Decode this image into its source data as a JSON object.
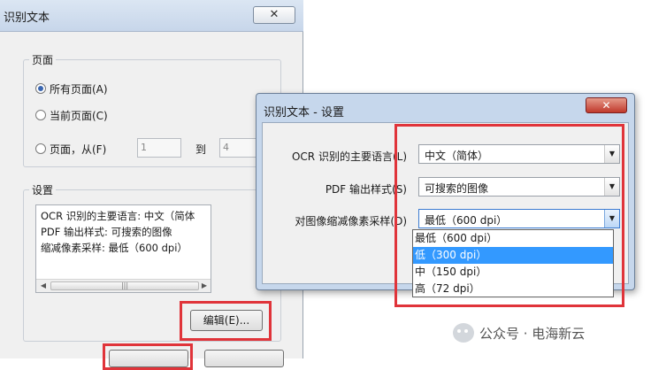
{
  "main_dialog": {
    "title": "识别文本",
    "close_symbol": "✕",
    "pages_group": {
      "label": "页面",
      "all_pages": "所有页面(A)",
      "current_page": "当前页面(C)",
      "page_range": "页面，从(F)",
      "from_value": "1",
      "to_label": "到",
      "to_value": "4",
      "selected": "all_pages"
    },
    "settings_group": {
      "label": "设置",
      "lines": [
        "OCR 识别的主要语言: 中文（简体",
        "PDF 输出样式: 可搜索的图像",
        "缩减像素采样: 最低（600 dpi）"
      ],
      "scroll_thumb_grip": "|||",
      "scroll_left": "◀",
      "scroll_right": "▶"
    },
    "edit_button": "编辑(E)..."
  },
  "settings_dialog": {
    "title": "识别文本 - 设置",
    "close_symbol": "✕",
    "fields": [
      {
        "label": "OCR 识别的主要语言(L)",
        "value": "中文（简体）"
      },
      {
        "label": "PDF 输出样式(S)",
        "value": "可搜索的图像"
      },
      {
        "label": "对图像缩减像素采样(D)",
        "value": "最低（600 dpi）"
      }
    ],
    "dropdown_arrow": "▼",
    "downsample_options": [
      "最低（600 dpi）",
      "低（300 dpi）",
      "中（150 dpi）",
      "高（72 dpi）"
    ],
    "highlighted_option_index": 1
  },
  "colors": {
    "highlight_red": "#e0343a",
    "selection_blue": "#3399ff"
  },
  "watermark": {
    "text": "公众号 · 电海新云",
    "icon": "wechat-icon"
  }
}
